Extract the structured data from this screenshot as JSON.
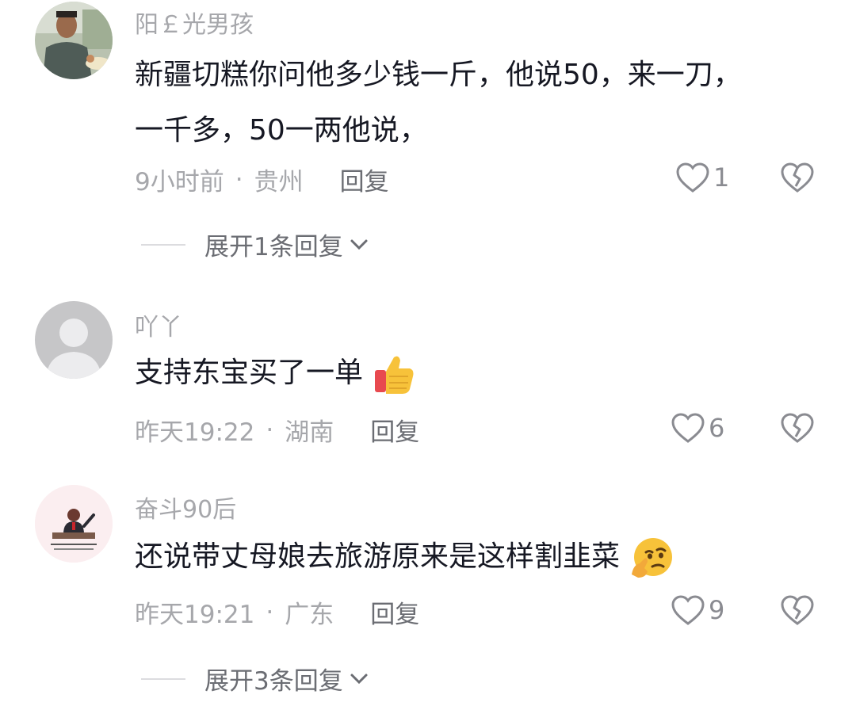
{
  "comments": [
    {
      "username": "阳￡光男孩",
      "text": "新疆切糕你问他多少钱一斤，他说50，来一刀，一千多，50一两他说，",
      "time": "9小时前",
      "location": "贵州",
      "reply_label": "回复",
      "likes": "1",
      "expand_label": "展开1条回复",
      "avatar": "photo-avatar-boy"
    },
    {
      "username": "吖丫",
      "text": "支持东宝买了一单",
      "emoji": "thumbs-up-emoji",
      "time": "昨天19:22",
      "location": "湖南",
      "reply_label": "回复",
      "likes": "6",
      "avatar": "default-grey-avatar"
    },
    {
      "username": "奋斗90后",
      "text": "还说带丈母娘去旅游原来是这样割韭菜",
      "emoji": "thinking-face-emoji",
      "time": "昨天19:21",
      "location": "广东",
      "reply_label": "回复",
      "likes": "9",
      "expand_label": "展开3条回复",
      "avatar": "speaker-illustration-avatar"
    }
  ],
  "separator": "·",
  "colors": {
    "secondary_text": "#a6a7ab",
    "primary_text": "#161823",
    "icon_grey": "#8a8b91"
  }
}
